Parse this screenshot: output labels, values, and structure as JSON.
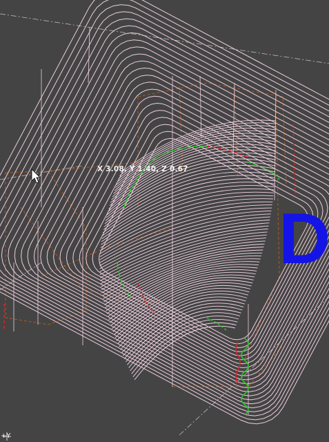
{
  "viewport": {
    "background": "#444444",
    "toolpath_color": "#f0cfe0",
    "stock_color": "#b05a20",
    "rapid_color_green": "#22cc22",
    "rapid_color_red": "#dd2222",
    "cursor_readout": "X 3.08, Y 1.40, Z 0.67",
    "axis_label": "+Y",
    "view_letter": "D",
    "view_letter_color": "#1414e6",
    "cursor_icon": "arrow-pointer-icon",
    "axis_icon": "axis-triad-icon"
  }
}
